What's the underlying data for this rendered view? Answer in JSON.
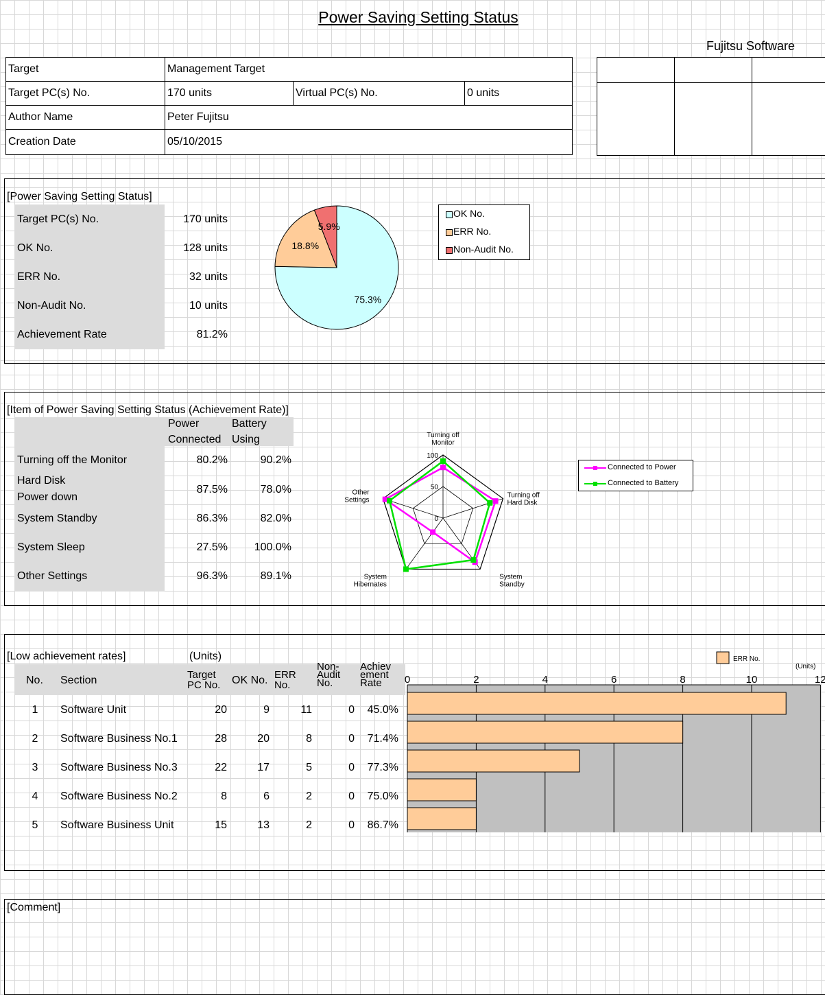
{
  "title": "Power Saving Setting Status",
  "company": "Fujitsu Software",
  "header": {
    "target_label": "Target",
    "target_value": "Management Target",
    "target_pcs_label": "Target PC(s) No.",
    "target_pcs_value": "170 units",
    "virtual_pcs_label": "Virtual PC(s) No.",
    "virtual_pcs_value": "0 units",
    "author_label": "Author Name",
    "author_value": "Peter Fujitsu",
    "date_label": "Creation Date",
    "date_value": "05/10/2015"
  },
  "status": {
    "section_title": "[Power Saving Setting Status]",
    "rows": [
      {
        "label": "Target PC(s) No.",
        "value": "170 units"
      },
      {
        "label": "OK No.",
        "value": "128 units"
      },
      {
        "label": "ERR No.",
        "value": "32 units"
      },
      {
        "label": "Non-Audit No.",
        "value": "10 units"
      },
      {
        "label": "Achievement Rate",
        "value": "81.2%"
      }
    ],
    "legend": [
      "OK No.",
      "ERR No.",
      "Non-Audit No."
    ]
  },
  "items": {
    "section_title": "[Item of Power Saving Setting Status (Achievement Rate)]",
    "col_power_1": "Power",
    "col_power_2": "Connected",
    "col_battery_1": "Battery",
    "col_battery_2": "Using",
    "rows": [
      {
        "label": "Turning off the Monitor",
        "label2": "",
        "power": "80.2%",
        "battery": "90.2%"
      },
      {
        "label": "Hard Disk",
        "label2": "Power down",
        "power": "87.5%",
        "battery": "78.0%"
      },
      {
        "label": "System Standby",
        "label2": "",
        "power": "86.3%",
        "battery": "82.0%"
      },
      {
        "label": "System Sleep",
        "label2": "",
        "power": "27.5%",
        "battery": "100.0%"
      },
      {
        "label": "Other Settings",
        "label2": "",
        "power": "96.3%",
        "battery": "89.1%"
      }
    ],
    "legend": [
      "Connected to Power",
      "Connected to Battery"
    ]
  },
  "low": {
    "section_title": "[Low achievement rates]",
    "units_label": "(Units)",
    "col_no": "No.",
    "col_section": "Section",
    "col_target": "Target PC No.",
    "col_ok": "OK No.",
    "col_err": "ERR No.",
    "col_nonaudit": "Non-Audit No.",
    "col_rate": "Achiev ement Rate",
    "legend": "ERR No.",
    "chart_units": "(Units)",
    "rows": [
      {
        "no": "1",
        "section": "Software Unit",
        "target": "20",
        "ok": "9",
        "err": "11",
        "nonaudit": "0",
        "rate": "45.0%"
      },
      {
        "no": "2",
        "section": "Software Business No.1",
        "target": "28",
        "ok": "20",
        "err": "8",
        "nonaudit": "0",
        "rate": "71.4%"
      },
      {
        "no": "3",
        "section": "Software Business No.3",
        "target": "22",
        "ok": "17",
        "err": "5",
        "nonaudit": "0",
        "rate": "77.3%"
      },
      {
        "no": "4",
        "section": "Software Business No.2",
        "target": "8",
        "ok": "6",
        "err": "2",
        "nonaudit": "0",
        "rate": "75.0%"
      },
      {
        "no": "5",
        "section": "Software Business Unit",
        "target": "15",
        "ok": "13",
        "err": "2",
        "nonaudit": "0",
        "rate": "86.7%"
      }
    ]
  },
  "comment_label": "[Comment]",
  "chart_data": [
    {
      "type": "pie",
      "categories": [
        "OK No.",
        "ERR No.",
        "Non-Audit No."
      ],
      "values": [
        75.3,
        18.8,
        5.9
      ],
      "labels": [
        "75.3%",
        "18.8%",
        "5.9%"
      ],
      "colors": [
        "#ccffff",
        "#ffcc99",
        "#f07070"
      ],
      "legend": "right"
    },
    {
      "type": "radar",
      "categories": [
        "Turning off Monitor",
        "Turning off Hard Disk",
        "System Standby",
        "System Hibernates",
        "Other Settings"
      ],
      "axis_ticks": [
        "100",
        "50",
        "0"
      ],
      "ylim": [
        0,
        100
      ],
      "series": [
        {
          "name": "Connected to Power",
          "values": [
            80.2,
            87.5,
            86.3,
            27.5,
            96.3
          ],
          "color": "#ff00ff"
        },
        {
          "name": "Connected to Battery",
          "values": [
            90.2,
            78.0,
            82.0,
            100.0,
            89.1
          ],
          "color": "#00e000"
        }
      ],
      "legend": "right"
    },
    {
      "type": "bar",
      "orientation": "horizontal",
      "categories": [
        "Software Unit",
        "Software Business No.1",
        "Software Business No.3",
        "Software Business No.2",
        "Software Business Unit"
      ],
      "values": [
        11,
        8,
        5,
        2,
        2
      ],
      "series_name": "ERR No.",
      "xlim": [
        0,
        12
      ],
      "ticks": [
        "0",
        "2",
        "4",
        "6",
        "8",
        "10",
        "12"
      ],
      "color": "#ffcc99",
      "legend": "top-right"
    }
  ]
}
